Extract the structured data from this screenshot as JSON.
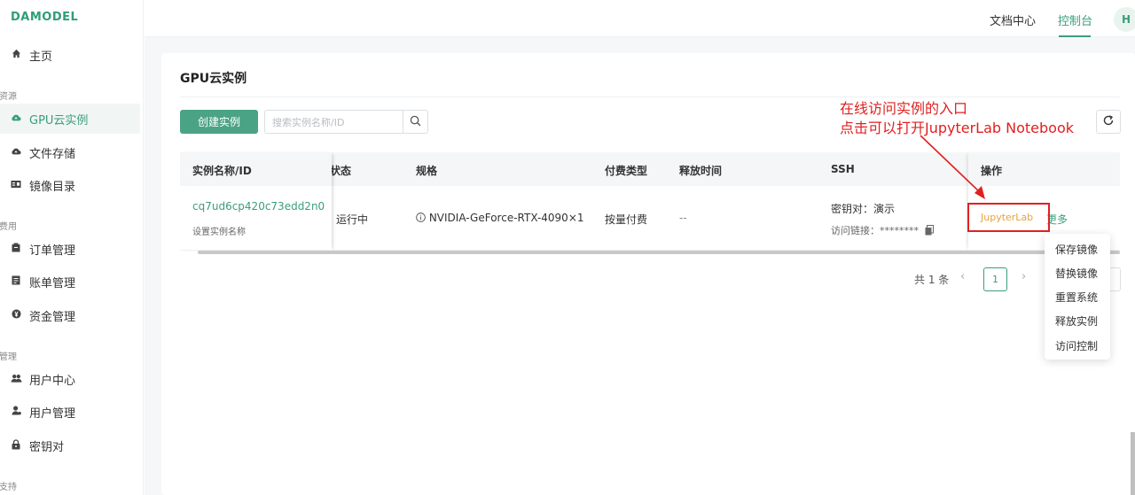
{
  "app": {
    "logo": "DAMODEL"
  },
  "sidebar": {
    "items": [
      {
        "label": "主页",
        "icon": "home-icon"
      },
      {
        "label": "GPU云实例",
        "icon": "cloud-icon"
      },
      {
        "label": "文件存储",
        "icon": "cloud-storage-icon"
      },
      {
        "label": "镜像目录",
        "icon": "image-catalog-icon"
      },
      {
        "label": "订单管理",
        "icon": "order-icon"
      },
      {
        "label": "账单管理",
        "icon": "bill-icon"
      },
      {
        "label": "资金管理",
        "icon": "yen-icon"
      },
      {
        "label": "用户中心",
        "icon": "users-icon"
      },
      {
        "label": "用户管理",
        "icon": "user-manage-icon"
      },
      {
        "label": "密钥对",
        "icon": "lock-icon"
      }
    ],
    "sections": [
      "资源",
      "费用",
      "管理",
      "支持"
    ]
  },
  "header": {
    "nav": [
      {
        "label": "文档中心"
      },
      {
        "label": "控制台"
      }
    ],
    "avatar": "H"
  },
  "main": {
    "title": "GPU云实例",
    "create_button": "创建实例",
    "search_placeholder": "搜索实例名称/ID",
    "table": {
      "columns": [
        "实例名称/ID",
        "状态",
        "规格",
        "付费类型",
        "释放时间",
        "SSH",
        "操作"
      ],
      "status_partial": "状态",
      "rows": [
        {
          "id": "cq7ud6cp420c73edd2n0",
          "name_hint": "设置实例名称",
          "status": "运行中",
          "spec": "NVIDIA-GeForce-RTX-4090×1",
          "billing": "按量付费",
          "release_time": "--",
          "ssh_keypair": "密钥对：演示",
          "ssh_link_label": "访问链接：",
          "ssh_link_masked": "********",
          "action_jupyter": "JupyterLab",
          "action_more": "更多"
        }
      ]
    },
    "pagination": {
      "total": "共 1 条",
      "current_page": "1"
    }
  },
  "dropdown": {
    "items": [
      "保存镜像",
      "替换镜像",
      "重置系统",
      "释放实例",
      "访问控制"
    ]
  },
  "annotation": {
    "line1": "在线访问实例的入口",
    "line2": "点击可以打开JupyterLab Notebook",
    "color": "#e02020"
  },
  "colors": {
    "accent": "#3a9e7c",
    "warning": "#e6a23c"
  }
}
